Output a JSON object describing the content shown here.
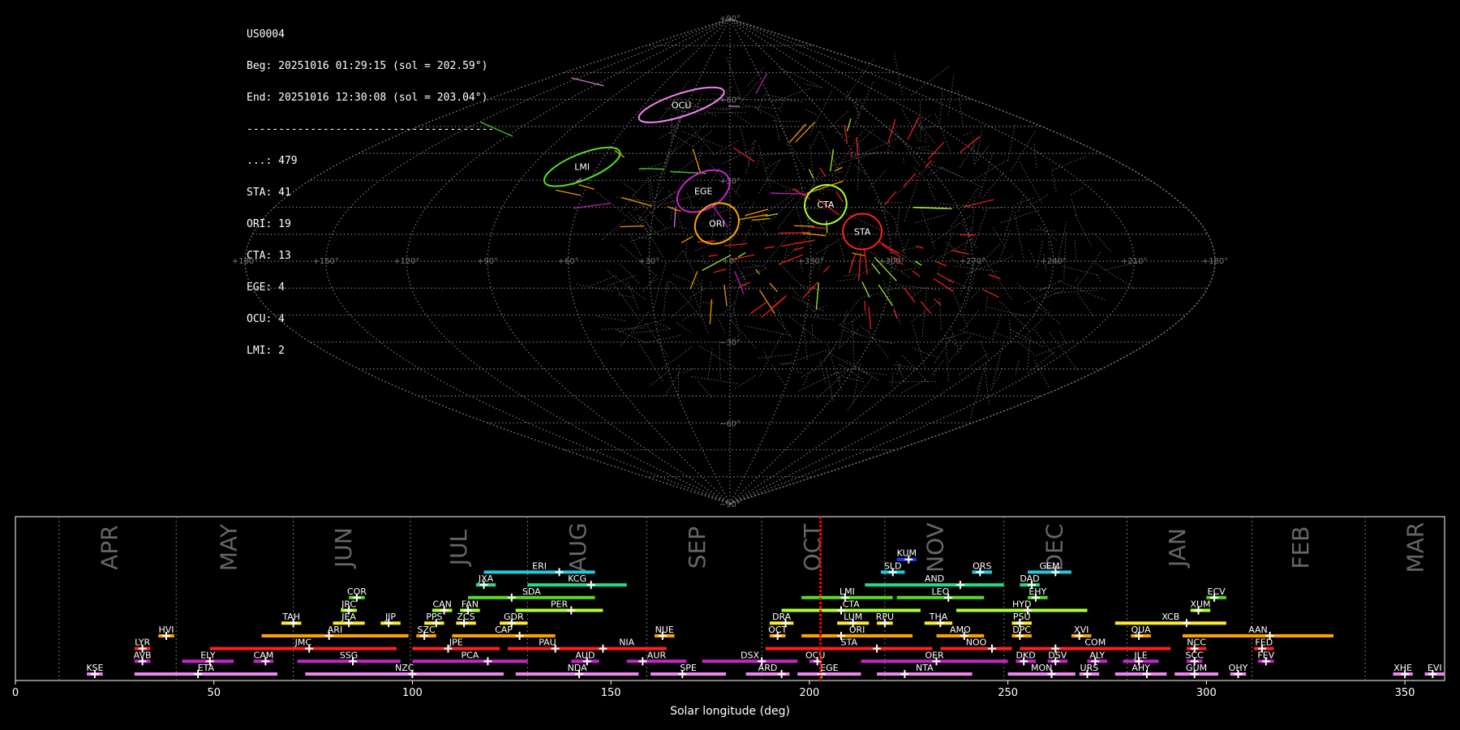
{
  "header": {
    "lines": [
      "US0004",
      "Beg: 20251016 01:29:15 (sol = 202.59°)",
      "End: 20251016 12:30:08 (sol = 203.04°)",
      "---------------------------------------",
      "...: 479",
      "STA: 41",
      "ORI: 19",
      "CTA: 13",
      "EGE: 4",
      "OCU: 4",
      "LMI: 2"
    ]
  },
  "colors": {
    "background": "#000000",
    "grid": "#7a7a7a",
    "sporadic": "#8a8a8a",
    "cursor": "#ff0000",
    "STA": "#ff2020",
    "ORI": "#ffa500",
    "CTA": "#adff2f",
    "EGE": "#cc22cc",
    "OCU": "#ee82ee",
    "LMI": "#55dd22"
  },
  "chart_data": [
    {
      "type": "scatter",
      "projection": "sinusoidal",
      "longitude_ticks": [
        "+180°",
        "+150°",
        "+120°",
        "+90°",
        "+60°",
        "+30°",
        "+0°",
        "+330°",
        "+300°",
        "+270°",
        "+240°",
        "+210°",
        "+180°"
      ],
      "latitude_ticks": [
        "+90°",
        "+60°",
        "+30°",
        "−30°",
        "−60°",
        "−90°"
      ],
      "grid": true,
      "radiants": [
        {
          "code": "OCU",
          "lon": 124,
          "lat": 58,
          "color": "#ee82ee"
        },
        {
          "code": "LMI",
          "lon": 157,
          "lat": 35,
          "color": "#55dd22"
        },
        {
          "code": "EGE",
          "lon": 101,
          "lat": 26,
          "color": "#cc22cc"
        },
        {
          "code": "ORI",
          "lon": 95,
          "lat": 14,
          "color": "#ffa500"
        },
        {
          "code": "CTA",
          "lon": 52,
          "lat": 21,
          "color": "#adff2f"
        },
        {
          "code": "STA",
          "lon": 40,
          "lat": 11,
          "color": "#ff2020"
        }
      ]
    },
    {
      "type": "bar",
      "xlabel": "Solar longitude (deg)",
      "xlim": [
        0,
        360
      ],
      "xticks": [
        0,
        50,
        100,
        150,
        200,
        250,
        300,
        350
      ],
      "cursor": 202.8,
      "months": [
        {
          "label": "APR",
          "start": 11,
          "center": 24
        },
        {
          "label": "MAY",
          "start": 40.5,
          "center": 54
        },
        {
          "label": "JUN",
          "start": 70,
          "center": 83
        },
        {
          "label": "JUL",
          "start": 99.5,
          "center": 112
        },
        {
          "label": "AUG",
          "start": 129,
          "center": 142
        },
        {
          "label": "SEP",
          "start": 159,
          "center": 172
        },
        {
          "label": "OCT",
          "start": 188,
          "center": 201
        },
        {
          "label": "NOV",
          "start": 219,
          "center": 232
        },
        {
          "label": "DEC",
          "start": 249,
          "center": 262
        },
        {
          "label": "JAN",
          "start": 280,
          "center": 293
        },
        {
          "label": "FEB",
          "start": 311.5,
          "center": 324
        },
        {
          "label": "MAR",
          "start": 340,
          "center": 353
        }
      ],
      "showers": [
        {
          "code": "KSE",
          "start": 18,
          "end": 22,
          "peak": 20,
          "row": 0,
          "color": "#ee82ee"
        },
        {
          "code": "ETA",
          "start": 30,
          "end": 66,
          "peak": 46,
          "row": 0,
          "color": "#ee82ee"
        },
        {
          "code": "NZC",
          "start": 73,
          "end": 123,
          "peak": 100,
          "row": 0,
          "color": "#ee82ee"
        },
        {
          "code": "NDA",
          "start": 126,
          "end": 157,
          "peak": 142,
          "row": 0,
          "color": "#ee82ee"
        },
        {
          "code": "SPE",
          "start": 160,
          "end": 179,
          "peak": 168,
          "row": 0,
          "color": "#ee82ee"
        },
        {
          "code": "ARD",
          "start": 184,
          "end": 195,
          "peak": 193,
          "row": 0,
          "color": "#ee82ee"
        },
        {
          "code": "EGE",
          "start": 197,
          "end": 213,
          "peak": 203,
          "row": 0,
          "color": "#ee82ee"
        },
        {
          "code": "NTA",
          "start": 217,
          "end": 241,
          "peak": 224,
          "row": 0,
          "color": "#ee82ee"
        },
        {
          "code": "MON",
          "start": 250,
          "end": 267,
          "peak": 261,
          "row": 0,
          "color": "#ee82ee"
        },
        {
          "code": "URS",
          "start": 268,
          "end": 273,
          "peak": 270,
          "row": 0,
          "color": "#ee82ee"
        },
        {
          "code": "AHY",
          "start": 277,
          "end": 290,
          "peak": 285,
          "row": 0,
          "color": "#ee82ee"
        },
        {
          "code": "GUM",
          "start": 292,
          "end": 303,
          "peak": 297,
          "row": 0,
          "color": "#ee82ee"
        },
        {
          "code": "OHY",
          "start": 306,
          "end": 310,
          "peak": 308,
          "row": 0,
          "color": "#ee82ee"
        },
        {
          "code": "XHE",
          "start": 347,
          "end": 352,
          "peak": 350,
          "row": 0,
          "color": "#ee82ee"
        },
        {
          "code": "EVI",
          "start": 355,
          "end": 360,
          "peak": 357,
          "row": 0,
          "color": "#ee82ee"
        },
        {
          "code": "AVB",
          "start": 30,
          "end": 34,
          "peak": 32,
          "row": 1,
          "color": "#cc22cc"
        },
        {
          "code": "ELY",
          "start": 42,
          "end": 55,
          "peak": 49,
          "row": 1,
          "color": "#cc22cc"
        },
        {
          "code": "CAM",
          "start": 60,
          "end": 65,
          "peak": 63,
          "row": 1,
          "color": "#cc22cc"
        },
        {
          "code": "SSG",
          "start": 71,
          "end": 97,
          "peak": 85,
          "row": 1,
          "color": "#cc22cc"
        },
        {
          "code": "PCA",
          "start": 100,
          "end": 129,
          "peak": 119,
          "row": 1,
          "color": "#cc22cc"
        },
        {
          "code": "AUD",
          "start": 140,
          "end": 147,
          "peak": 144,
          "row": 1,
          "color": "#cc22cc"
        },
        {
          "code": "AUR",
          "start": 154,
          "end": 169,
          "peak": 158,
          "row": 1,
          "color": "#cc22cc"
        },
        {
          "code": "DSX",
          "start": 173,
          "end": 197,
          "peak": 188,
          "row": 1,
          "color": "#cc22cc"
        },
        {
          "code": "OCU",
          "start": 200,
          "end": 203,
          "peak": 202,
          "row": 1,
          "color": "#cc22cc"
        },
        {
          "code": "OER",
          "start": 213,
          "end": 250,
          "peak": 232,
          "row": 1,
          "color": "#cc22cc"
        },
        {
          "code": "DKD",
          "start": 252,
          "end": 257,
          "peak": 254,
          "row": 1,
          "color": "#cc22cc"
        },
        {
          "code": "DSV",
          "start": 260,
          "end": 265,
          "peak": 262,
          "row": 1,
          "color": "#cc22cc"
        },
        {
          "code": "ALY",
          "start": 270,
          "end": 275,
          "peak": 272,
          "row": 1,
          "color": "#cc22cc"
        },
        {
          "code": "JLE",
          "start": 279,
          "end": 288,
          "peak": 283,
          "row": 1,
          "color": "#cc22cc"
        },
        {
          "code": "SCC",
          "start": 295,
          "end": 299,
          "peak": 297,
          "row": 1,
          "color": "#cc22cc"
        },
        {
          "code": "FEV",
          "start": 313,
          "end": 317,
          "peak": 315,
          "row": 1,
          "color": "#cc22cc"
        },
        {
          "code": "LYR",
          "start": 30,
          "end": 34,
          "peak": 32,
          "row": 2,
          "color": "#ff2020"
        },
        {
          "code": "JMC",
          "start": 49,
          "end": 96,
          "peak": 74,
          "row": 2,
          "color": "#ff2020"
        },
        {
          "code": "JPE",
          "start": 100,
          "end": 122,
          "peak": 109,
          "row": 2,
          "color": "#ff2020"
        },
        {
          "code": "PAU",
          "start": 124,
          "end": 144,
          "peak": 136,
          "row": 2,
          "color": "#ff2020"
        },
        {
          "code": "NIA",
          "start": 144,
          "end": 164,
          "peak": 148,
          "row": 2,
          "color": "#ff2020"
        },
        {
          "code": "STA",
          "start": 189,
          "end": 231,
          "peak": 217,
          "row": 2,
          "color": "#ff2020"
        },
        {
          "code": "NOO",
          "start": 233,
          "end": 251,
          "peak": 246,
          "row": 2,
          "color": "#ff2020"
        },
        {
          "code": "COM",
          "start": 253,
          "end": 291,
          "peak": 262,
          "row": 2,
          "color": "#ff2020"
        },
        {
          "code": "NCC",
          "start": 295,
          "end": 300,
          "peak": 297,
          "row": 2,
          "color": "#ff2020"
        },
        {
          "code": "FED",
          "start": 312,
          "end": 317,
          "peak": 314,
          "row": 2,
          "color": "#ff2020"
        },
        {
          "code": "HVI",
          "start": 36,
          "end": 40,
          "peak": 38,
          "row": 3,
          "color": "#ffa500"
        },
        {
          "code": "ARI",
          "start": 62,
          "end": 99,
          "peak": 79,
          "row": 3,
          "color": "#ffa500"
        },
        {
          "code": "SZC",
          "start": 101,
          "end": 106,
          "peak": 103,
          "row": 3,
          "color": "#ffa500"
        },
        {
          "code": "CAP",
          "start": 110,
          "end": 136,
          "peak": 127,
          "row": 3,
          "color": "#ffa500"
        },
        {
          "code": "NUE",
          "start": 161,
          "end": 166,
          "peak": 163,
          "row": 3,
          "color": "#ffa500"
        },
        {
          "code": "OCT",
          "start": 190,
          "end": 194,
          "peak": 192,
          "row": 3,
          "color": "#ffa500"
        },
        {
          "code": "ORI",
          "start": 198,
          "end": 226,
          "peak": 208,
          "row": 3,
          "color": "#ffa500"
        },
        {
          "code": "AMO",
          "start": 232,
          "end": 244,
          "peak": 239,
          "row": 3,
          "color": "#ffa500"
        },
        {
          "code": "DPC",
          "start": 251,
          "end": 256,
          "peak": 253,
          "row": 3,
          "color": "#ffa500"
        },
        {
          "code": "XVI",
          "start": 266,
          "end": 271,
          "peak": 268,
          "row": 3,
          "color": "#ffa500"
        },
        {
          "code": "QUA",
          "start": 281,
          "end": 286,
          "peak": 283,
          "row": 3,
          "color": "#ffa500"
        },
        {
          "code": "AAN",
          "start": 294,
          "end": 332,
          "peak": 316,
          "row": 3,
          "color": "#ffa500"
        },
        {
          "code": "TAH",
          "start": 67,
          "end": 72,
          "peak": 70,
          "row": 4,
          "color": "#ffee22"
        },
        {
          "code": "JEA",
          "start": 80,
          "end": 88,
          "peak": 84,
          "row": 4,
          "color": "#ffee22"
        },
        {
          "code": "JIP",
          "start": 92,
          "end": 97,
          "peak": 94,
          "row": 4,
          "color": "#ffee22"
        },
        {
          "code": "PPS",
          "start": 103,
          "end": 108,
          "peak": 106,
          "row": 4,
          "color": "#ffee22"
        },
        {
          "code": "ZCS",
          "start": 111,
          "end": 116,
          "peak": 113,
          "row": 4,
          "color": "#ffee22"
        },
        {
          "code": "GDR",
          "start": 122,
          "end": 129,
          "peak": 125,
          "row": 4,
          "color": "#ffee22"
        },
        {
          "code": "DRA",
          "start": 190,
          "end": 196,
          "peak": 194,
          "row": 4,
          "color": "#ffee22"
        },
        {
          "code": "LUM",
          "start": 207,
          "end": 215,
          "peak": 211,
          "row": 4,
          "color": "#ffee22"
        },
        {
          "code": "RPU",
          "start": 217,
          "end": 221,
          "peak": 219,
          "row": 4,
          "color": "#ffee22"
        },
        {
          "code": "THA",
          "start": 229,
          "end": 236,
          "peak": 233,
          "row": 4,
          "color": "#ffee22"
        },
        {
          "code": "PSU",
          "start": 251,
          "end": 256,
          "peak": 253,
          "row": 4,
          "color": "#ffee22"
        },
        {
          "code": "XCB",
          "start": 277,
          "end": 305,
          "peak": 295,
          "row": 4,
          "color": "#ffee22"
        },
        {
          "code": "JRC",
          "start": 82,
          "end": 86,
          "peak": 84,
          "row": 5,
          "color": "#adff2f"
        },
        {
          "code": "CAN",
          "start": 105,
          "end": 110,
          "peak": 108,
          "row": 5,
          "color": "#adff2f"
        },
        {
          "code": "FAN",
          "start": 112,
          "end": 117,
          "peak": 114,
          "row": 5,
          "color": "#adff2f"
        },
        {
          "code": "PER",
          "start": 126,
          "end": 148,
          "peak": 140,
          "row": 5,
          "color": "#adff2f"
        },
        {
          "code": "CTA",
          "start": 193,
          "end": 228,
          "peak": 208,
          "row": 5,
          "color": "#adff2f"
        },
        {
          "code": "HYD",
          "start": 237,
          "end": 270,
          "peak": 255,
          "row": 5,
          "color": "#adff2f"
        },
        {
          "code": "XUM",
          "start": 296,
          "end": 301,
          "peak": 298,
          "row": 5,
          "color": "#adff2f"
        },
        {
          "code": "COR",
          "start": 84,
          "end": 88,
          "peak": 86,
          "row": 6,
          "color": "#55dd22"
        },
        {
          "code": "SDA",
          "start": 114,
          "end": 146,
          "peak": 125,
          "row": 6,
          "color": "#55dd22"
        },
        {
          "code": "LMI",
          "start": 198,
          "end": 221,
          "peak": 209,
          "row": 6,
          "color": "#55dd22"
        },
        {
          "code": "LEO",
          "start": 222,
          "end": 244,
          "peak": 235,
          "row": 6,
          "color": "#55dd22"
        },
        {
          "code": "EHY",
          "start": 255,
          "end": 260,
          "peak": 257,
          "row": 6,
          "color": "#55dd22"
        },
        {
          "code": "ECV",
          "start": 300,
          "end": 305,
          "peak": 302,
          "row": 6,
          "color": "#55dd22"
        },
        {
          "code": "JXA",
          "start": 116,
          "end": 121,
          "peak": 118,
          "row": 7,
          "color": "#22dd88"
        },
        {
          "code": "KCG",
          "start": 129,
          "end": 154,
          "peak": 145,
          "row": 7,
          "color": "#22dd88"
        },
        {
          "code": "AND",
          "start": 214,
          "end": 249,
          "peak": 238,
          "row": 7,
          "color": "#22dd88"
        },
        {
          "code": "DAD",
          "start": 253,
          "end": 258,
          "peak": 256,
          "row": 7,
          "color": "#22dd88"
        },
        {
          "code": "ERI",
          "start": 118,
          "end": 146,
          "peak": 137,
          "row": 8,
          "color": "#22ccdd"
        },
        {
          "code": "SLD",
          "start": 218,
          "end": 224,
          "peak": 221,
          "row": 8,
          "color": "#22ccdd"
        },
        {
          "code": "ORS",
          "start": 241,
          "end": 246,
          "peak": 243,
          "row": 8,
          "color": "#22ccdd"
        },
        {
          "code": "GEM",
          "start": 255,
          "end": 266,
          "peak": 262,
          "row": 8,
          "color": "#22ccdd"
        },
        {
          "code": "KUM",
          "start": 222,
          "end": 227,
          "peak": 225,
          "row": 9,
          "color": "#2233ff"
        }
      ]
    }
  ]
}
